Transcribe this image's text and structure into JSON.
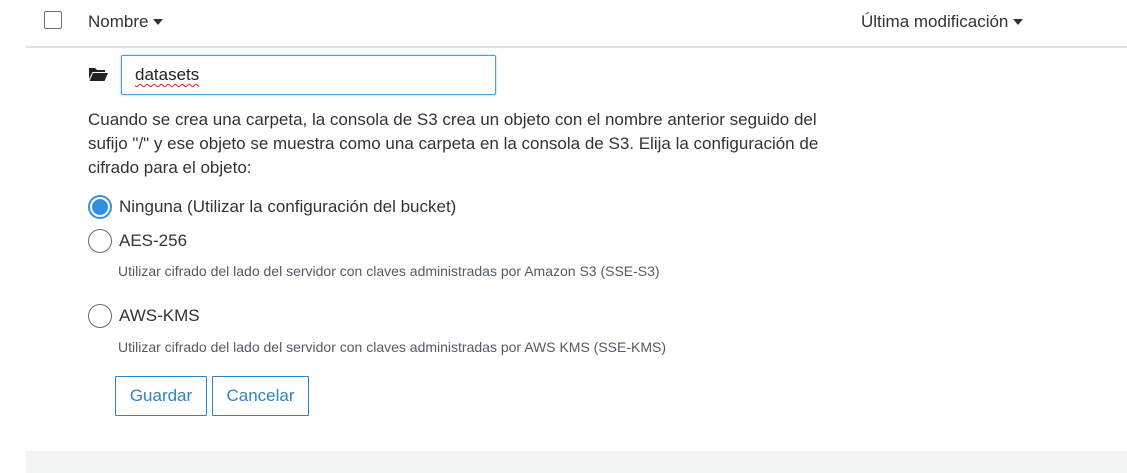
{
  "table_header": {
    "name_label": "Nombre",
    "modified_label": "Última modificación"
  },
  "folder": {
    "name_value": "datasets"
  },
  "description": "Cuando se crea una carpeta, la consola de S3 crea un objeto con el nombre anterior seguido del sufijo \"/\" y ese objeto se muestra como una carpeta en la consola de S3. Elija la configuración de cifrado para el objeto:",
  "encryption": {
    "selected": "none",
    "options": [
      {
        "id": "none",
        "label": "Ninguna (Utilizar la configuración del bucket)",
        "help": ""
      },
      {
        "id": "aes256",
        "label": "AES-256",
        "help": "Utilizar cifrado del lado del servidor con claves administradas por Amazon S3 (SSE-S3)"
      },
      {
        "id": "awskms",
        "label": "AWS-KMS",
        "help": "Utilizar cifrado del lado del servidor con claves administradas por AWS KMS (SSE-KMS)"
      }
    ]
  },
  "actions": {
    "save_label": "Guardar",
    "cancel_label": "Cancelar"
  },
  "colors": {
    "accent": "#2e84c6",
    "radio_selected": "#2f8fe0",
    "header_border": "#e1e4e6"
  },
  "icons": {
    "folder": "folder-open-icon",
    "sort": "caret-down-icon"
  }
}
